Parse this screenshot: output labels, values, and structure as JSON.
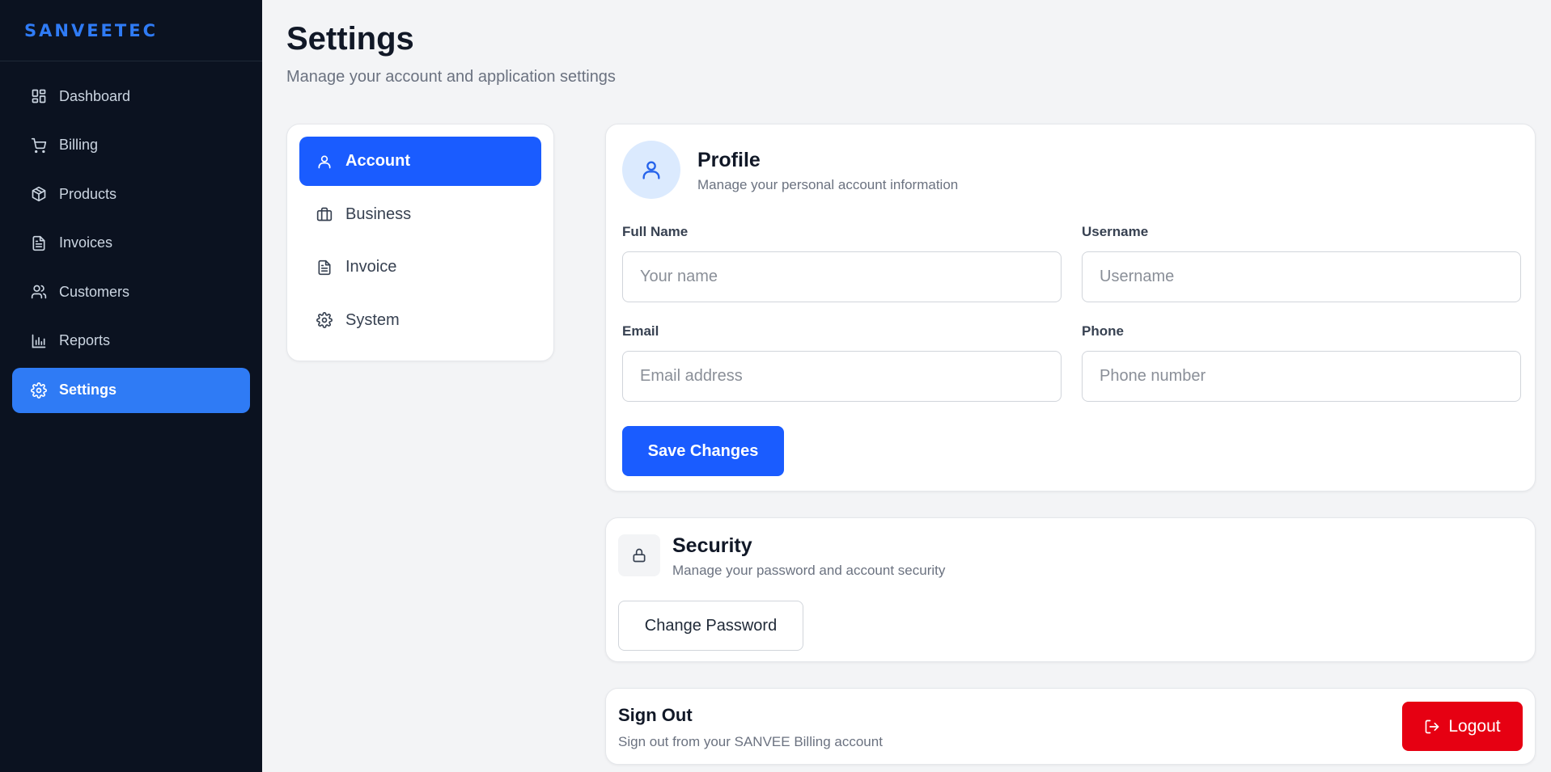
{
  "brand": "SANVEETEC",
  "sidebar": {
    "items": [
      {
        "label": "Dashboard",
        "icon": "dashboard-icon"
      },
      {
        "label": "Billing",
        "icon": "cart-icon"
      },
      {
        "label": "Products",
        "icon": "package-icon"
      },
      {
        "label": "Invoices",
        "icon": "file-icon"
      },
      {
        "label": "Customers",
        "icon": "users-icon"
      },
      {
        "label": "Reports",
        "icon": "bar-chart-icon"
      },
      {
        "label": "Settings",
        "icon": "gear-icon",
        "active": true
      }
    ]
  },
  "header": {
    "title": "Settings",
    "subtitle": "Manage your account and application settings"
  },
  "tabs": [
    {
      "label": "Account",
      "icon": "user-icon",
      "active": true
    },
    {
      "label": "Business",
      "icon": "briefcase-icon"
    },
    {
      "label": "Invoice",
      "icon": "file-icon"
    },
    {
      "label": "System",
      "icon": "gear-icon"
    }
  ],
  "profile": {
    "title": "Profile",
    "subtitle": "Manage your personal account information",
    "fields": {
      "full_name": {
        "label": "Full Name",
        "placeholder": "Your name",
        "value": ""
      },
      "username": {
        "label": "Username",
        "placeholder": "Username",
        "value": ""
      },
      "email": {
        "label": "Email",
        "placeholder": "Email address",
        "value": ""
      },
      "phone": {
        "label": "Phone",
        "placeholder": "Phone number",
        "value": ""
      }
    },
    "save_label": "Save Changes"
  },
  "security": {
    "title": "Security",
    "subtitle": "Manage your password and account security",
    "button_label": "Change Password"
  },
  "signout": {
    "title": "Sign Out",
    "subtitle": "Sign out from your SANVEE Billing account",
    "button_label": "Logout"
  },
  "colors": {
    "sidebar_bg": "#0b1220",
    "brand": "#2f7bf5",
    "primary": "#1a5cff",
    "danger": "#e60012",
    "page_bg": "#f3f4f6"
  }
}
